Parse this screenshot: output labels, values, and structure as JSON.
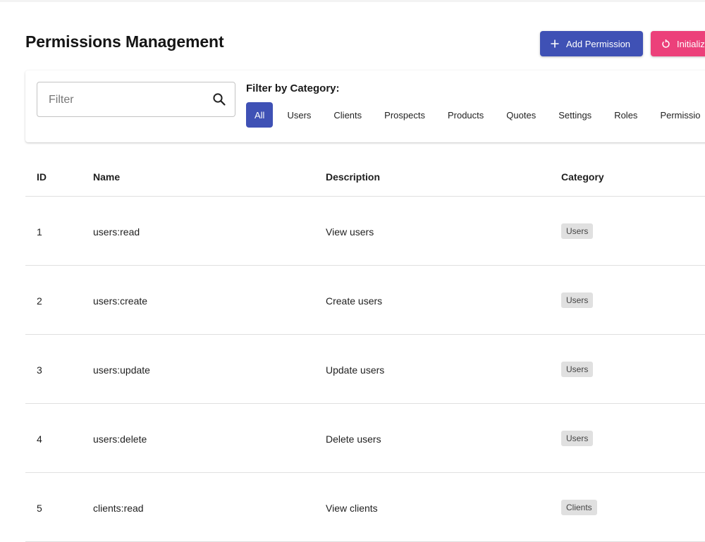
{
  "header": {
    "title": "Permissions Management",
    "add_button_label": "Add Permission",
    "init_button_label": "Initializ",
    "add_icon": "plus-icon",
    "init_icon": "refresh-icon"
  },
  "filter": {
    "placeholder": "Filter",
    "value": "",
    "search_icon": "search-icon",
    "category_label": "Filter by Category:",
    "categories": [
      "All",
      "Users",
      "Clients",
      "Prospects",
      "Products",
      "Quotes",
      "Settings",
      "Roles",
      "Permissio"
    ],
    "selected": "All"
  },
  "table": {
    "columns": [
      "ID",
      "Name",
      "Description",
      "Category"
    ],
    "rows": [
      {
        "id": "1",
        "name": "users:read",
        "description": "View users",
        "category": "Users"
      },
      {
        "id": "2",
        "name": "users:create",
        "description": "Create users",
        "category": "Users"
      },
      {
        "id": "3",
        "name": "users:update",
        "description": "Update users",
        "category": "Users"
      },
      {
        "id": "4",
        "name": "users:delete",
        "description": "Delete users",
        "category": "Users"
      },
      {
        "id": "5",
        "name": "clients:read",
        "description": "View clients",
        "category": "Clients"
      }
    ]
  },
  "colors": {
    "primary": "#3f51b5",
    "secondary": "#ec407a",
    "badge_bg": "#e0e0e0"
  }
}
